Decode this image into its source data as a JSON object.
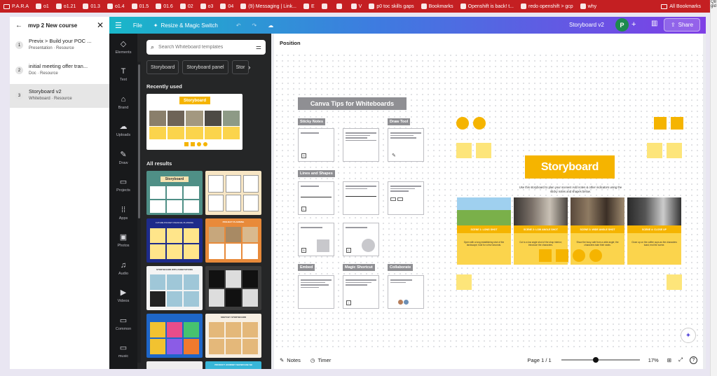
{
  "bookmarks": [
    "P.A.R.A",
    "o1",
    "o1.21",
    "01.3",
    "o1.4",
    "01.5",
    "01.6",
    "02",
    "o3",
    "04",
    "(9) Messaging | Link...",
    "E",
    "",
    "",
    "V",
    "p0 toc skills gaps",
    "Bookmarks",
    "Openshift is back! t...",
    "redo openshift > gcp",
    "why"
  ],
  "bookmarks_right": "All Bookmarks",
  "edge_text": "Q8\ngid",
  "course_panel": {
    "title": "mvp 2 New course",
    "items": [
      {
        "num": "1",
        "title": "Previx > Build your POC ...",
        "sub": "Presentation · Resource"
      },
      {
        "num": "2",
        "title": "initial meeting offer tran...",
        "sub": "Doc · Resource"
      },
      {
        "num": "3",
        "title": "Storyboard v2",
        "sub": "Whiteboard · Resource"
      }
    ]
  },
  "topbar": {
    "file": "File",
    "resize": "Resize & Magic Switch",
    "doc_title": "Storyboard v2",
    "avatar_letter": "P",
    "share": "Share"
  },
  "rail": [
    {
      "icon": "elements-icon",
      "glyph": "◇",
      "label": "Elements"
    },
    {
      "icon": "text-icon",
      "glyph": "T",
      "label": "Text"
    },
    {
      "icon": "brand-icon",
      "glyph": "⌂",
      "label": "Brand"
    },
    {
      "icon": "uploads-icon",
      "glyph": "☁",
      "label": "Uploads"
    },
    {
      "icon": "draw-icon",
      "glyph": "✎",
      "label": "Draw"
    },
    {
      "icon": "projects-icon",
      "glyph": "▭",
      "label": "Projects"
    },
    {
      "icon": "apps-icon",
      "glyph": "⁞⁞",
      "label": "Apps"
    },
    {
      "icon": "photos-icon",
      "glyph": "▣",
      "label": "Photos"
    },
    {
      "icon": "audio-icon",
      "glyph": "♫",
      "label": "Audio"
    },
    {
      "icon": "videos-icon",
      "glyph": "▶",
      "label": "Videos"
    },
    {
      "icon": "common-icon",
      "glyph": "▭",
      "label": "Common"
    },
    {
      "icon": "music-icon",
      "glyph": "▭",
      "label": "music"
    }
  ],
  "templates": {
    "search_placeholder": "Search Whiteboard templates",
    "chips": [
      "Storyboard",
      "Storyboard panel",
      "Stor"
    ],
    "recently_used": "Recently used",
    "recent_title": "Storyboard",
    "all_results": "All results",
    "result_title": "Storyboard",
    "result_titles": [
      "FUTURE POCKET FINANCIAL PLANNING",
      "PROJECT PLANNING",
      "STORYBOARD WITH ANNOTATIONS",
      "",
      "",
      "SKETCHY STORYBOARD",
      "",
      "PRODUCT JOURNEY SHOWCASE SB"
    ]
  },
  "canvas": {
    "position_label": "Position",
    "tips_title": "Canva Tips for Whiteboards",
    "tip_labels": [
      "Sticky Notes",
      "Draw Tool",
      "Lines and Shapes",
      "Embed",
      "Magic Shortcut",
      "Collaborate"
    ],
    "keys": [
      "S",
      "L",
      "R",
      "C",
      "/"
    ],
    "story_title": "Storyboard",
    "story_sub": "Use this storyboard to plan your scenes! Add notes & other indicators using the sticky notes and shapes below.",
    "scenes": [
      {
        "label": "SCENE 1: LONG SHOT",
        "body": "Open with a long establishing shot of the landscape; hold for a few seconds."
      },
      {
        "label": "SCENE 2: LOW ANGLE SHOT",
        "body": "Cut to a low angle shot of the shop interior; introduce the characters."
      },
      {
        "label": "SCENE 3: WIDE ANGLE SHOT",
        "body": "Show the busy cafe from a wide angle; the characters take their seats."
      },
      {
        "label": "SCENE 4: CLOSE UP",
        "body": "Close up on the coffee cups as the characters toast; end the scene."
      }
    ]
  },
  "bottom": {
    "notes": "Notes",
    "timer": "Timer",
    "page": "Page 1 / 1",
    "zoom_pct": "17%",
    "zoom_value": 0.17
  },
  "colors": {
    "accent_yellow": "#f5b400",
    "note_yellow": "#fde57a",
    "bookmark_red": "#c41f22"
  }
}
